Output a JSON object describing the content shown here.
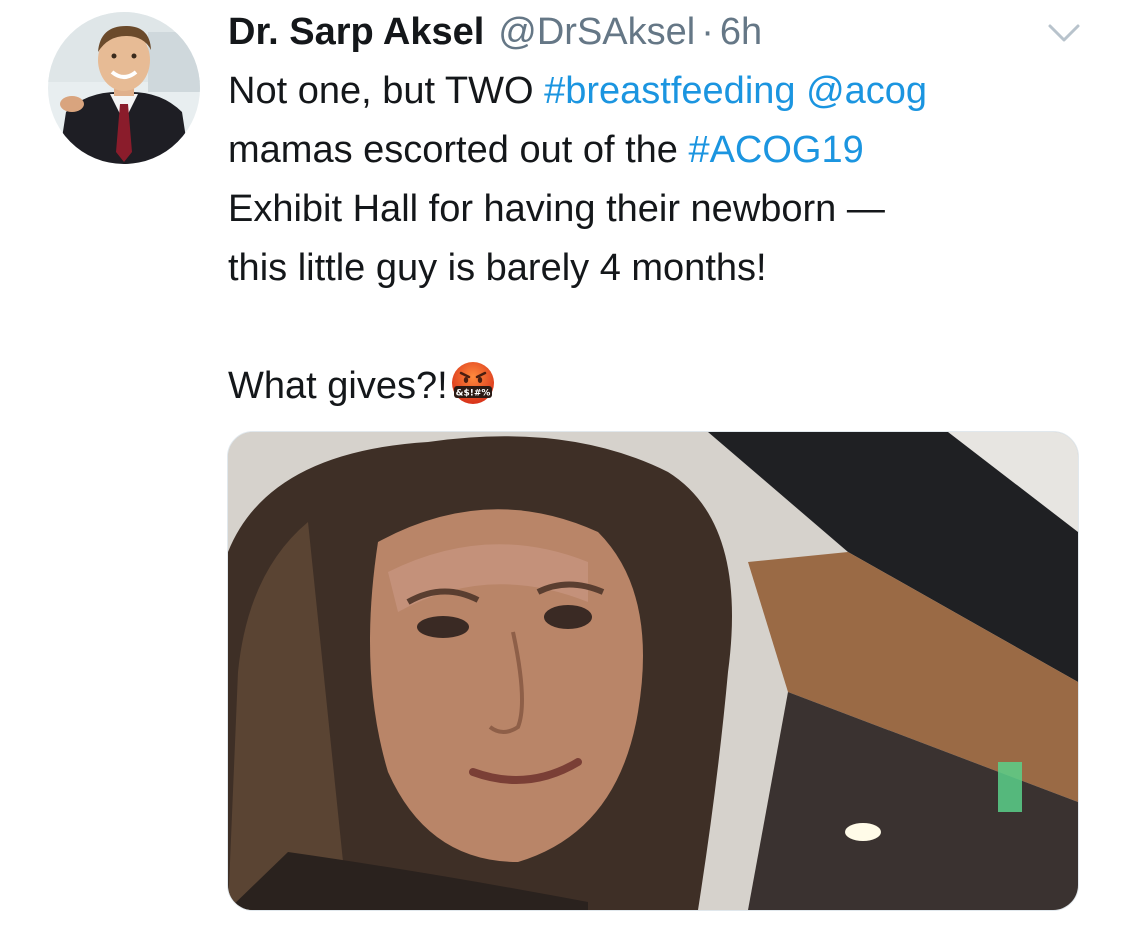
{
  "tweet": {
    "author_name": "Dr. Sarp Aksel",
    "handle": "@DrSAksel",
    "separator": "·",
    "time": "6h",
    "text": {
      "line1_plain": "Not one, but TWO ",
      "line1_hashtag": "#breastfeeding",
      "line1_space": " ",
      "line1_mention": "@acog",
      "line2_plain": "mamas escorted out of the ",
      "line2_hashtag": "#ACOG19",
      "line3": "Exhibit Hall for having their newborn —",
      "line4": "this little guy is barely 4 months!",
      "line5": "What gives?!"
    },
    "emoji_text": "&$!#%",
    "icons": {
      "avatar": "avatar-photo",
      "menu": "chevron-down-icon",
      "emoji": "face-with-symbols-on-mouth-emoji",
      "media": "selfie-photo"
    },
    "colors": {
      "link": "#1b95e0",
      "muted": "#657786",
      "text": "#14171a"
    }
  }
}
